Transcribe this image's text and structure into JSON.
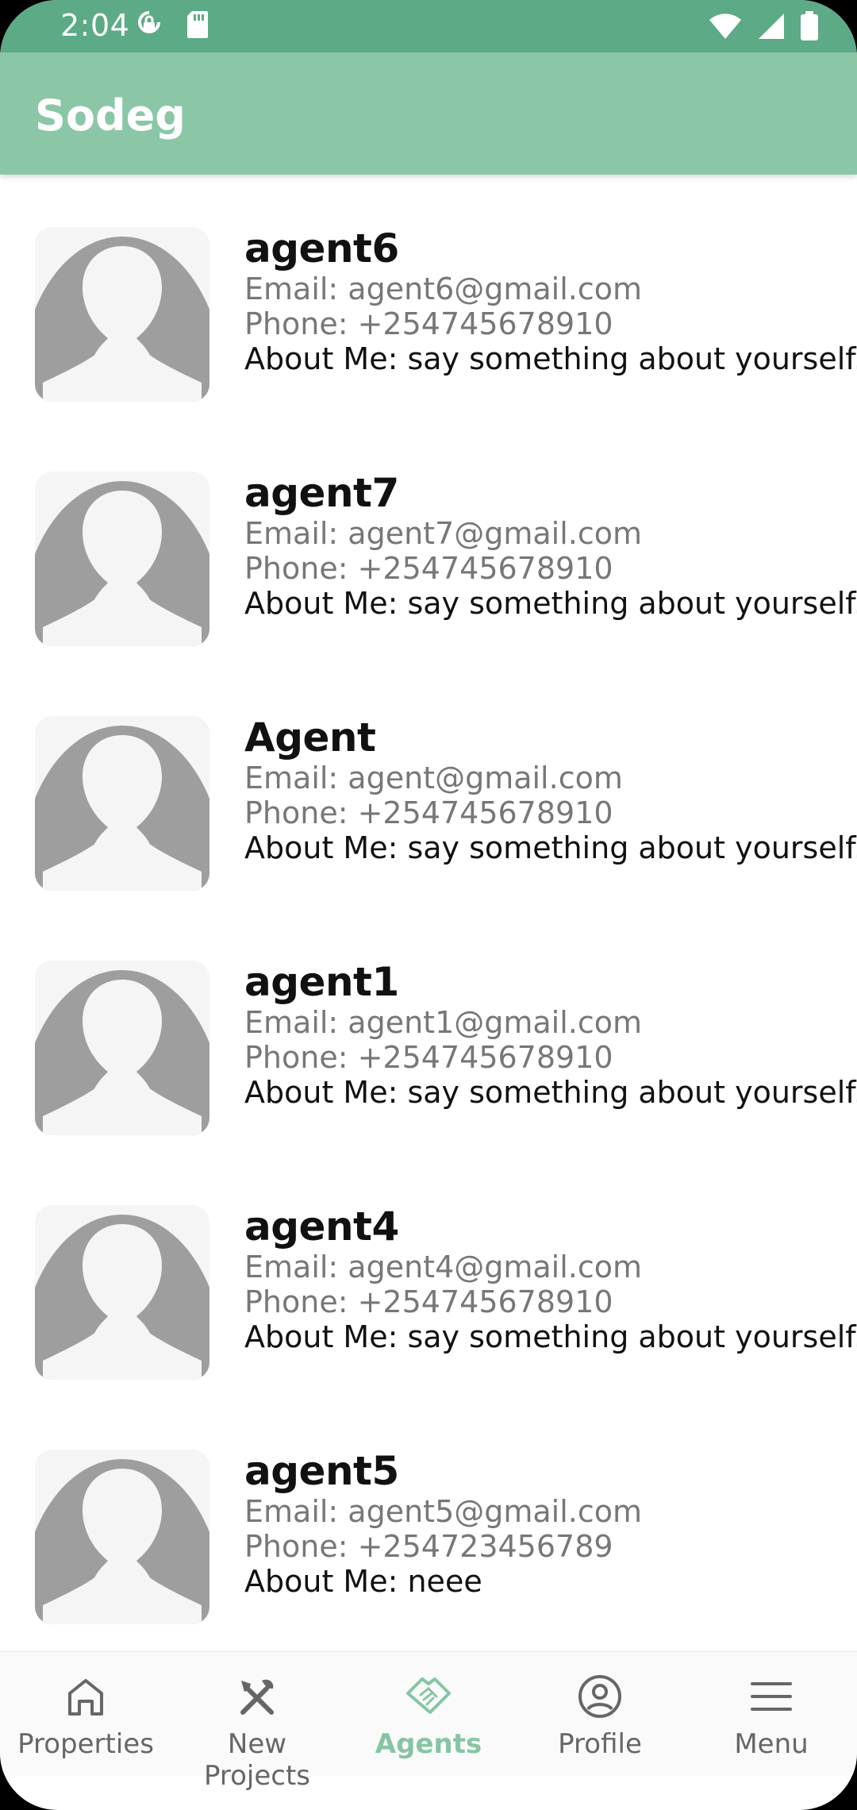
{
  "status_bar": {
    "time": "2:04",
    "left_icons": [
      "sync-lock-icon",
      "sd-card-icon"
    ],
    "right_icons": [
      "wifi-icon",
      "signal-icon",
      "battery-icon"
    ]
  },
  "app_bar": {
    "title": "Sodeg"
  },
  "agents": [
    {
      "name": "agent6",
      "email": "Email: agent6@gmail.com",
      "phone": "Phone: +254745678910",
      "about": "About Me: say something about yourself..."
    },
    {
      "name": "agent7",
      "email": "Email: agent7@gmail.com",
      "phone": "Phone: +254745678910",
      "about": "About Me: say something about yourself..."
    },
    {
      "name": "Agent",
      "email": "Email: agent@gmail.com",
      "phone": "Phone: +254745678910",
      "about": "About Me: say something about yourself..."
    },
    {
      "name": "agent1",
      "email": "Email: agent1@gmail.com",
      "phone": "Phone: +254745678910",
      "about": "About Me: say something about yourself..."
    },
    {
      "name": "agent4",
      "email": "Email: agent4@gmail.com",
      "phone": "Phone: +254745678910",
      "about": "About Me: say something about yourself..."
    },
    {
      "name": "agent5",
      "email": "Email: agent5@gmail.com",
      "phone": "Phone: +254723456789",
      "about": "About Me: neee"
    }
  ],
  "bottom_nav": {
    "items": [
      {
        "label": "Properties",
        "icon": "home-icon",
        "active": false
      },
      {
        "label": "New Projects",
        "icon": "tools-icon",
        "active": false
      },
      {
        "label": "Agents",
        "icon": "handshake-icon",
        "active": true
      },
      {
        "label": "Profile",
        "icon": "account-circle-icon",
        "active": false
      },
      {
        "label": "Menu",
        "icon": "menu-icon",
        "active": false
      }
    ]
  },
  "colors": {
    "status_bar": "#5daa86",
    "app_bar": "#8bc7a7",
    "accent": "#86c5a4",
    "avatar_fg": "#9e9e9e",
    "avatar_bg": "#f5f5f5"
  }
}
